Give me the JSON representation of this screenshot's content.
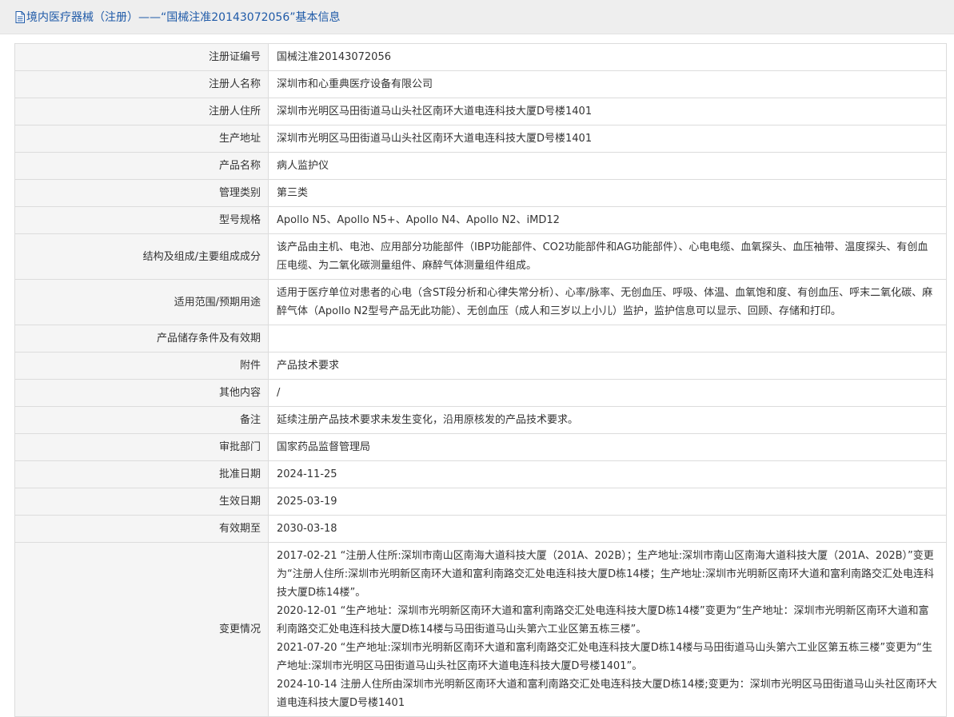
{
  "header": {
    "icon": "document-icon",
    "title": "境内医疗器械（注册）——“国械注准20143072056”基本信息"
  },
  "fields": [
    {
      "label": "注册证编号",
      "value": "国械注准20143072056"
    },
    {
      "label": "注册人名称",
      "value": "深圳市和心重典医疗设备有限公司"
    },
    {
      "label": "注册人住所",
      "value": "深圳市光明区马田街道马山头社区南环大道电连科技大厦D号楼1401"
    },
    {
      "label": "生产地址",
      "value": "深圳市光明区马田街道马山头社区南环大道电连科技大厦D号楼1401"
    },
    {
      "label": "产品名称",
      "value": "病人监护仪"
    },
    {
      "label": "管理类别",
      "value": "第三类"
    },
    {
      "label": "型号规格",
      "value": "Apollo N5、Apollo N5+、Apollo N4、Apollo N2、iMD12"
    },
    {
      "label": "结构及组成/主要组成成分",
      "value": "该产品由主机、电池、应用部分功能部件（IBP功能部件、CO2功能部件和AG功能部件）、心电电缆、血氧探头、血压袖带、温度探头、有创血压电缆、为二氧化碳测量组件、麻醉气体测量组件组成。"
    },
    {
      "label": "适用范围/预期用途",
      "value": "适用于医疗单位对患者的心电（含ST段分析和心律失常分析）、心率/脉率、无创血压、呼吸、体温、血氧饱和度、有创血压、呼末二氧化碳、麻醉气体（Apollo N2型号产品无此功能）、无创血压（成人和三岁以上小儿）监护，监护信息可以显示、回顾、存储和打印。"
    },
    {
      "label": "产品储存条件及有效期",
      "value": ""
    },
    {
      "label": "附件",
      "value": "产品技术要求"
    },
    {
      "label": "其他内容",
      "value": "/"
    },
    {
      "label": "备注",
      "value": "延续注册产品技术要求未发生变化，沿用原核发的产品技术要求。"
    },
    {
      "label": "审批部门",
      "value": "国家药品监督管理局"
    },
    {
      "label": "批准日期",
      "value": "2024-11-25"
    },
    {
      "label": "生效日期",
      "value": "2025-03-19"
    },
    {
      "label": "有效期至",
      "value": "2030-03-18"
    }
  ],
  "changes": {
    "label": "变更情况",
    "entries": [
      "2017-02-21 “注册人住所:深圳市南山区南海大道科技大厦（201A、202B）；生产地址:深圳市南山区南海大道科技大厦（201A、202B）”变更为“注册人住所:深圳市光明新区南环大道和富利南路交汇处电连科技大厦D栋14楼；生产地址:深圳市光明新区南环大道和富利南路交汇处电连科技大厦D栋14楼”。",
      "2020-12-01 “生产地址：深圳市光明新区南环大道和富利南路交汇处电连科技大厦D栋14楼”变更为“生产地址：深圳市光明新区南环大道和富利南路交汇处电连科技大厦D栋14楼与马田街道马山头第六工业区第五栋三楼”。",
      "2021-07-20 “生产地址:深圳市光明新区南环大道和富利南路交汇处电连科技大厦D栋14楼与马田街道马山头第六工业区第五栋三楼”变更为“生产地址:深圳市光明区马田街道马山头社区南环大道电连科技大厦D号楼1401”。",
      "2024-10-14 注册人住所由深圳市光明新区南环大道和富利南路交汇处电连科技大厦D栋14楼;变更为：深圳市光明区马田街道马山头社区南环大道电连科技大厦D号楼1401"
    ]
  }
}
